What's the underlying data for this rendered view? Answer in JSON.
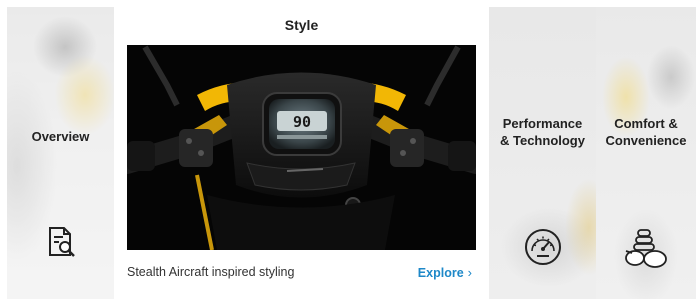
{
  "panels": {
    "overview": {
      "title": "Overview",
      "icon": "document-search-icon"
    },
    "style": {
      "title": "Style",
      "caption": "Stealth Aircraft inspired styling",
      "explore_label": "Explore",
      "explore_icon": "chevron-right-icon",
      "hero_image": "scooter-dashboard-image",
      "dashboard_readout": "90",
      "accent_color": "#f2b705"
    },
    "performance": {
      "title_line1": "Performance",
      "title_line2": "& Technology",
      "icon": "speedometer-icon"
    },
    "comfort": {
      "title_line1": "Comfort &",
      "title_line2": "Convenience",
      "icon": "seat-comfort-icon"
    }
  },
  "colors": {
    "link": "#1e88c8",
    "accent": "#f2b705"
  }
}
